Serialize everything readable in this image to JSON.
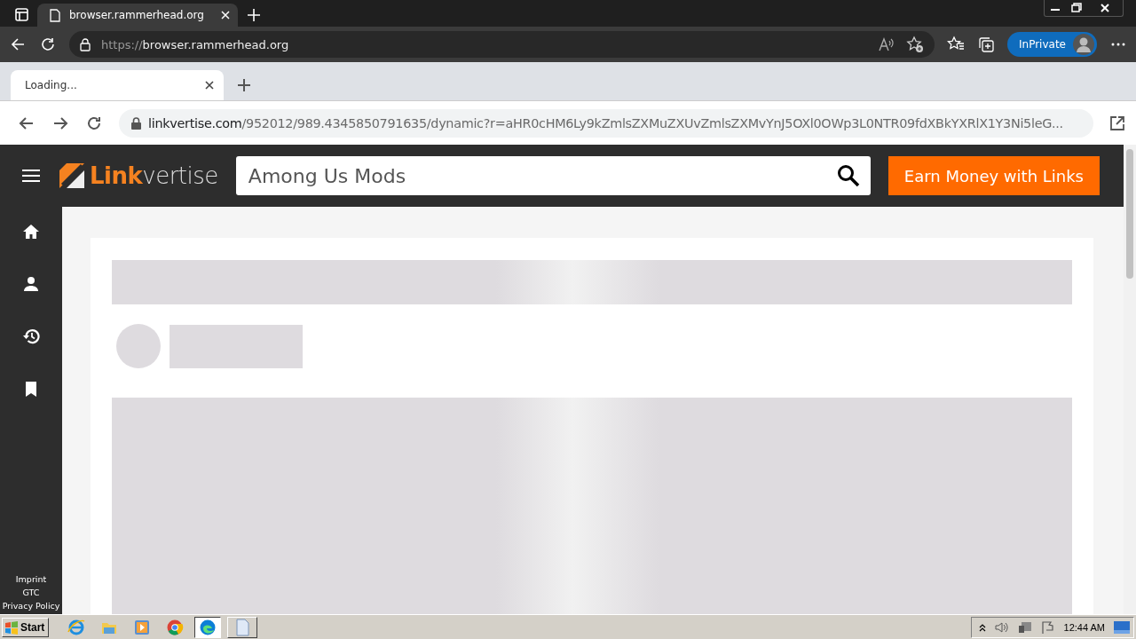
{
  "edge": {
    "tabs": [
      {
        "title": "browser.rammerhead.org",
        "selected": true
      }
    ],
    "address": {
      "scheme": "https://",
      "host": "browser.rammerhead.org"
    },
    "profile": {
      "label": "InPrivate"
    }
  },
  "proxy": {
    "tabs": [
      {
        "title": "Loading...",
        "selected": true
      }
    ],
    "address": {
      "host": "linkvertise.com",
      "path": "/952012/989.4345850791635/dynamic?r=aHR0cHM6Ly9kZmlsZXMuZXUvZmlsZXMvYnJ5OXl0OWp3L0NTR09fdXBkYXRlX1Y3Ni5leG..."
    }
  },
  "site": {
    "logo": {
      "bold": "Link",
      "light": "vertise"
    },
    "search": {
      "value": "Among Us Mods"
    },
    "cta": "Earn Money with Links",
    "nav": [
      {
        "kind": "home",
        "selected": false
      },
      {
        "kind": "user",
        "selected": false
      },
      {
        "kind": "history",
        "selected": false
      },
      {
        "kind": "bookmark",
        "selected": false
      }
    ],
    "footer_links": [
      "Imprint",
      "GTC",
      "Privacy Policy"
    ]
  },
  "taskbar": {
    "start": "Start",
    "apps": [
      {
        "kind": "ie",
        "selected": false
      },
      {
        "kind": "folder",
        "selected": false
      },
      {
        "kind": "media",
        "selected": false
      },
      {
        "kind": "chrome",
        "selected": false
      },
      {
        "kind": "edge",
        "selected": true
      },
      {
        "kind": "notepad",
        "selected": false
      }
    ],
    "clock": "12:44 AM"
  }
}
